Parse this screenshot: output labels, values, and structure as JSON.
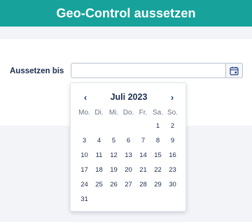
{
  "header": {
    "title": "Geo-Control aussetzen"
  },
  "form": {
    "label": "Aussetzen bis",
    "date_value": "",
    "date_placeholder": ""
  },
  "datepicker": {
    "month_label": "Juli 2023",
    "prev_symbol": "‹",
    "next_symbol": "›",
    "weekdays": [
      "Mo.",
      "Di.",
      "Mi.",
      "Do.",
      "Fr.",
      "Sa.",
      "So."
    ],
    "leading_blank_days": 5,
    "days": [
      "1",
      "2",
      "3",
      "4",
      "5",
      "6",
      "7",
      "8",
      "9",
      "10",
      "11",
      "12",
      "13",
      "14",
      "15",
      "16",
      "17",
      "18",
      "19",
      "20",
      "21",
      "22",
      "23",
      "24",
      "25",
      "26",
      "27",
      "28",
      "29",
      "30",
      "31"
    ]
  },
  "colors": {
    "header_bg": "#17a39b",
    "accent": "#1c3f8a",
    "text": "#1c2d4f"
  },
  "icons": {
    "calendar_button": "calendar-icon"
  }
}
